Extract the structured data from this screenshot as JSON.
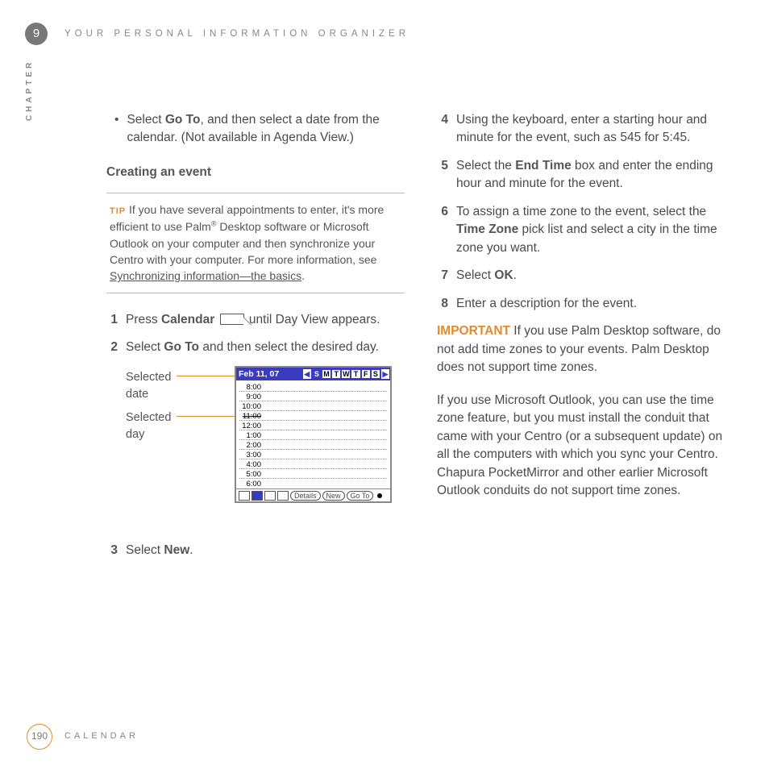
{
  "header": {
    "chapter_num": "9",
    "title": "Your Personal Information Organizer",
    "side_label": "CHAPTER"
  },
  "footer": {
    "page": "190",
    "section": "Calendar"
  },
  "left": {
    "bullet": {
      "pre": "Select ",
      "bold": "Go To",
      "post": ", and then select a date from the calendar. (Not available in Agenda View.)"
    },
    "heading": "Creating an event",
    "tip": {
      "label": "TIP",
      "t1": "If you have several appointments to enter, it's more efficient to use Palm",
      "sup": "®",
      "t2": " Desktop software or Microsoft Outlook on your computer and then synchronize your Centro with your computer. For more information, see ",
      "link": "Synchronizing information—the basics",
      "t3": "."
    },
    "steps": {
      "s1": {
        "num": "1",
        "pre": "Press ",
        "bold": "Calendar",
        "post": " until Day View appears."
      },
      "s2": {
        "num": "2",
        "pre": "Select ",
        "bold": "Go To",
        "post": " and then select the desired day."
      },
      "s3": {
        "num": "3",
        "pre": "Select ",
        "bold": "New",
        "post": "."
      }
    },
    "callouts": {
      "date1": "Selected",
      "date2": "date",
      "day1": "Selected",
      "day2": "day"
    },
    "device": {
      "date": "Feb 11, 07",
      "days": [
        "S",
        "M",
        "T",
        "W",
        "T",
        "F",
        "S"
      ],
      "times": [
        "8:00",
        "9:00",
        "10:00",
        "11:00",
        "12:00",
        "1:00",
        "2:00",
        "3:00",
        "4:00",
        "5:00",
        "6:00"
      ],
      "btn_details": "Details",
      "btn_new": "New",
      "btn_goto": "Go To"
    }
  },
  "right": {
    "s4": {
      "num": "4",
      "text": "Using the keyboard, enter a starting hour and minute for the event, such as 545 for 5:45."
    },
    "s5": {
      "num": "5",
      "pre": "Select the ",
      "bold": "End Time",
      "post": " box and enter the ending hour and minute for the event."
    },
    "s6": {
      "num": "6",
      "pre": "To assign a time zone to the event, select the ",
      "bold": "Time Zone",
      "post": " pick list and select a city in the time zone you want."
    },
    "s7": {
      "num": "7",
      "pre": "Select ",
      "bold": "OK",
      "post": "."
    },
    "s8": {
      "num": "8",
      "text": "Enter a description for the event."
    },
    "important": {
      "label": "IMPORTANT",
      "text": "If you use Palm Desktop software, do not add time zones to your events. Palm Desktop does not support time zones."
    },
    "para": "If you use Microsoft Outlook, you can use the time zone feature, but you must install the conduit that came with your Centro (or a subsequent update) on all the computers with which you sync your Centro. Chapura PocketMirror and other earlier Microsoft Outlook conduits do not support time zones."
  }
}
